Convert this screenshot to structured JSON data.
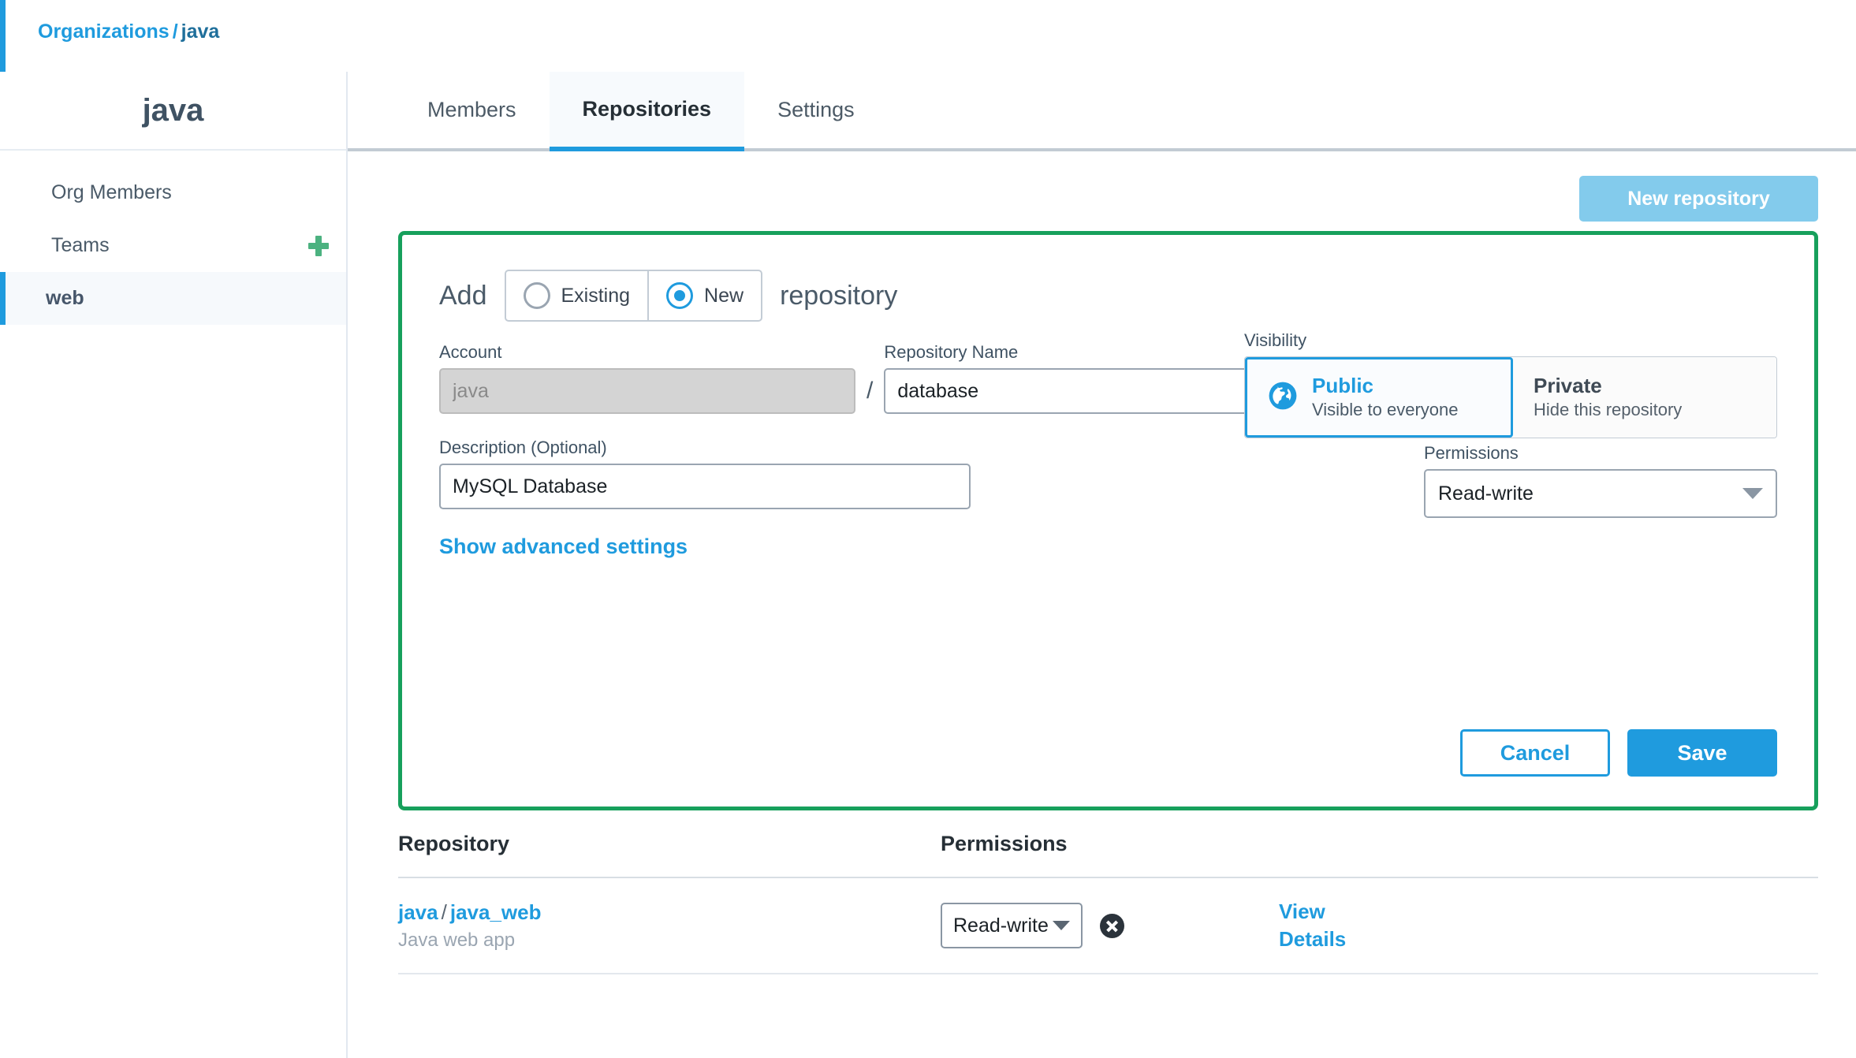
{
  "breadcrumb": {
    "root": "Organizations",
    "separator": "/",
    "current": "java"
  },
  "sidebar": {
    "org_title": "java",
    "items": [
      {
        "label": "Org Members",
        "active": false,
        "has_add": false
      },
      {
        "label": "Teams",
        "active": false,
        "has_add": true,
        "add_icon": "plus-icon"
      },
      {
        "label": "web",
        "active": true,
        "has_add": false
      }
    ]
  },
  "tabs": [
    {
      "label": "Members",
      "active": false
    },
    {
      "label": "Repositories",
      "active": true
    },
    {
      "label": "Settings",
      "active": false
    }
  ],
  "toolbar": {
    "new_repository_label": "New repository"
  },
  "add_panel": {
    "border_color": "#17a05c",
    "prefix_word": "Add",
    "suffix_word": "repository",
    "mode_options": [
      {
        "label": "Existing",
        "selected": false
      },
      {
        "label": "New",
        "selected": true
      }
    ],
    "account": {
      "label": "Account",
      "value": "",
      "placeholder": "java",
      "disabled": true
    },
    "separator": "/",
    "repository_name": {
      "label": "Repository Name",
      "value": "database",
      "placeholder": ""
    },
    "description": {
      "label": "Description (Optional)",
      "value": "MySQL Database",
      "placeholder": ""
    },
    "visibility": {
      "label": "Visibility",
      "options": [
        {
          "title": "Public",
          "subtitle": "Visible to everyone",
          "icon": "globe-icon",
          "selected": true
        },
        {
          "title": "Private",
          "subtitle": "Hide this repository",
          "icon": "",
          "selected": false
        }
      ]
    },
    "permissions": {
      "label": "Permissions",
      "value": "Read-write"
    },
    "advanced_link": "Show advanced settings",
    "cancel_label": "Cancel",
    "save_label": "Save"
  },
  "repo_table": {
    "columns": {
      "repository": "Repository",
      "permissions": "Permissions"
    },
    "rows": [
      {
        "owner": "java",
        "separator": "/",
        "name": "java_web",
        "description": "Java web app",
        "permission": "Read-write",
        "view_details_line1": "View",
        "view_details_line2": "Details"
      }
    ]
  },
  "colors": {
    "accent_blue": "#1f9bde",
    "panel_green": "#17a05c",
    "plus_green": "#4cb280",
    "disabled_blue": "#83cbec"
  }
}
